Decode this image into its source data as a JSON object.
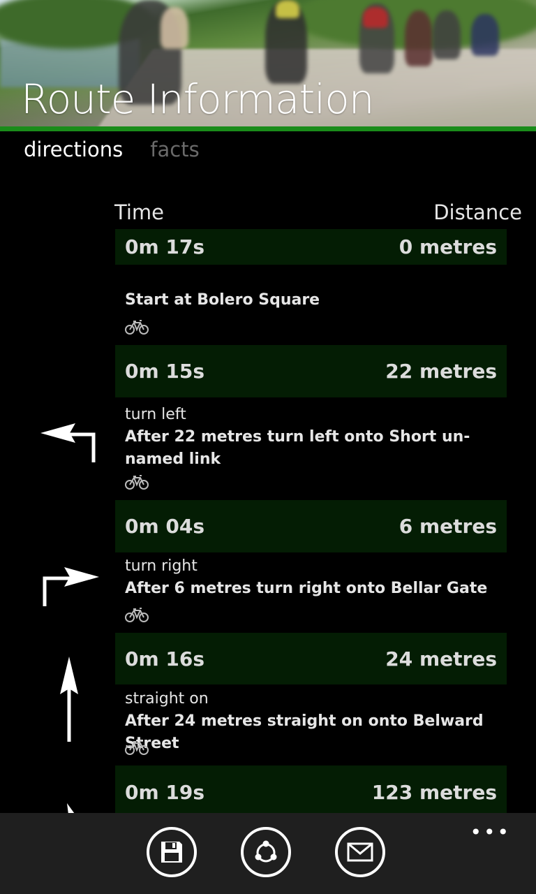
{
  "header": {
    "title": "Route Information"
  },
  "colors": {
    "accent": "#1a8c1a",
    "bar_bg": "#041d04",
    "appbar_bg": "#1f1f1f"
  },
  "tabs": [
    {
      "label": "directions",
      "active": true
    },
    {
      "label": "facts",
      "active": false
    }
  ],
  "columns": {
    "time": "Time",
    "distance": "Distance"
  },
  "steps": [
    {
      "time": "0m 17s",
      "distance": "0 metres",
      "maneuver": "",
      "instruction": "Start at Bolero Square",
      "icon": "none"
    },
    {
      "time": "0m 15s",
      "distance": "22 metres",
      "maneuver": "turn left",
      "instruction": "After 22 metres turn left onto Short un-named link",
      "icon": "turn-left-arrow-icon"
    },
    {
      "time": "0m 04s",
      "distance": "6 metres",
      "maneuver": "turn right",
      "instruction": "After 6 metres turn right onto Bellar Gate",
      "icon": "turn-right-arrow-icon"
    },
    {
      "time": "0m 16s",
      "distance": "24 metres",
      "maneuver": "straight on",
      "instruction": "After 24 metres straight on onto Belward Street",
      "icon": "straight-arrow-icon"
    },
    {
      "time": "0m 19s",
      "distance": "123 metres",
      "maneuver": "",
      "instruction": "",
      "icon": "bear-right-arrow-icon"
    }
  ],
  "appbar": {
    "buttons": [
      {
        "name": "save",
        "icon": "save-icon"
      },
      {
        "name": "share",
        "icon": "share-icon"
      },
      {
        "name": "email",
        "icon": "mail-icon"
      }
    ],
    "more": "•••"
  }
}
